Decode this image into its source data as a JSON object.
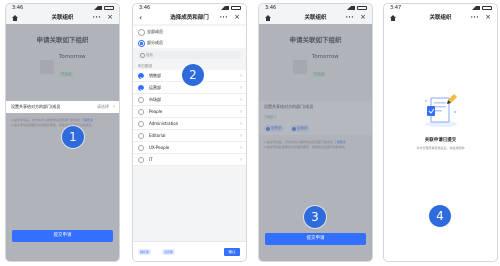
{
  "status_time": [
    "3:46",
    "3:46",
    "3:46",
    "3:47"
  ],
  "nav_titles": [
    "关联组织",
    "选择成员和部门",
    "关联组织",
    "关联组织"
  ],
  "steps": [
    "1",
    "2",
    "3",
    "4"
  ],
  "request": {
    "title": "申请关联如下组织",
    "org_name": "Tomorrow",
    "org_badge": "已认证",
    "scope_label": "设置共享给对方的部门/成员",
    "scope_value": "请选择",
    "desc_line1": "1.提交申请后，对方将可以看到你设置的部门和成员",
    "desc_link": "了解更多",
    "desc_line2": "2.提交申请后需要对方管理员审核，审核通过后即可关联成功",
    "submit": "提交申请"
  },
  "picker": {
    "option_all": "全部成员",
    "option_part": "部分成员",
    "search_placeholder": "搜索",
    "breadcrumb": "明日集团",
    "depts": [
      {
        "name": "销售部",
        "checked": true
      },
      {
        "name": "运营部",
        "checked": true
      },
      {
        "name": "市场部",
        "checked": false
      },
      {
        "name": "People",
        "checked": false
      },
      {
        "name": "Administration",
        "checked": false
      },
      {
        "name": "Editorial",
        "checked": false
      },
      {
        "name": "UX-People",
        "checked": false
      },
      {
        "name": "IT",
        "checked": false
      }
    ],
    "chips": [
      "销售部",
      "运营部"
    ],
    "confirm": "确认"
  },
  "selected": {
    "scope_label": "设置共享给对方的部门/成员",
    "dept_label": "下属部门",
    "chips": [
      "销售部",
      "运营部"
    ],
    "submit": "提交申请"
  },
  "success": {
    "title": "关联申请已提交",
    "desc": "对方管理员审核通过后，将会通知你"
  },
  "colors": {
    "accent": "#3370ff",
    "marker": "#2e6bdc"
  }
}
